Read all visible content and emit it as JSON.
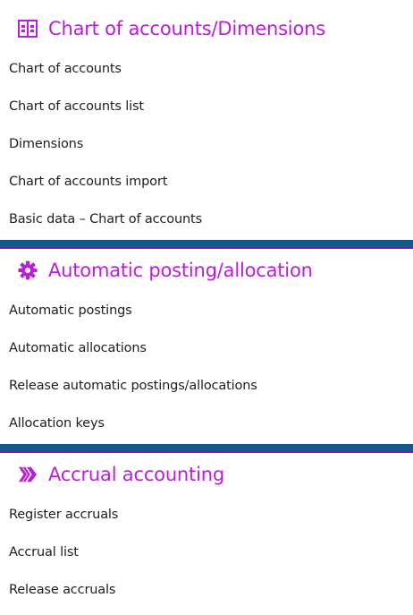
{
  "colors": {
    "accent": "#b91fd6",
    "divider": "#135a8a",
    "divider_edge": "#6e1fb2",
    "text": "#1e1e1e"
  },
  "sections": [
    {
      "title": "Chart of accounts/Dimensions",
      "icon": "table-grid-icon",
      "items": [
        "Chart of accounts",
        "Chart of accounts list",
        "Dimensions",
        "Chart of accounts import",
        "Basic data – Chart of accounts"
      ]
    },
    {
      "title": "Automatic posting/allocation",
      "icon": "gear-icon",
      "items": [
        "Automatic postings",
        "Automatic allocations",
        "Release automatic postings/allocations",
        "Allocation keys"
      ]
    },
    {
      "title": "Accrual accounting",
      "icon": "striped-arrow-icon",
      "items": [
        "Register accruals",
        "Accrual list",
        "Release accruals"
      ]
    }
  ]
}
